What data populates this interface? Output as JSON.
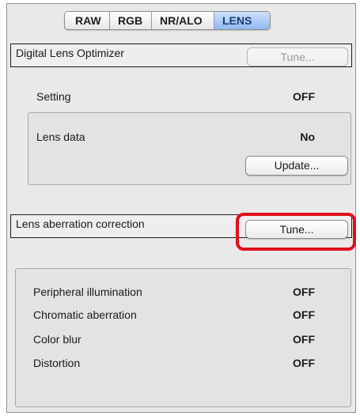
{
  "tabs": [
    {
      "label": "RAW",
      "active": false
    },
    {
      "label": "RGB",
      "active": false
    },
    {
      "label": "NR/ALO",
      "active": false
    },
    {
      "label": "LENS",
      "active": true
    }
  ],
  "dlo": {
    "title": "Digital Lens Optimizer",
    "tune_label": "Tune...",
    "setting_label": "Setting",
    "setting_value": "OFF",
    "lens_data_label": "Lens data",
    "lens_data_value": "No",
    "update_label": "Update..."
  },
  "aberration": {
    "title": "Lens aberration correction",
    "tune_label": "Tune...",
    "items": [
      {
        "label": "Peripheral illumination",
        "value": "OFF"
      },
      {
        "label": "Chromatic aberration",
        "value": "OFF"
      },
      {
        "label": "Color blur",
        "value": "OFF"
      },
      {
        "label": "Distortion",
        "value": "OFF"
      }
    ]
  },
  "colors": {
    "highlight": "#e0101b",
    "active_tab": "#8fb9ef"
  }
}
